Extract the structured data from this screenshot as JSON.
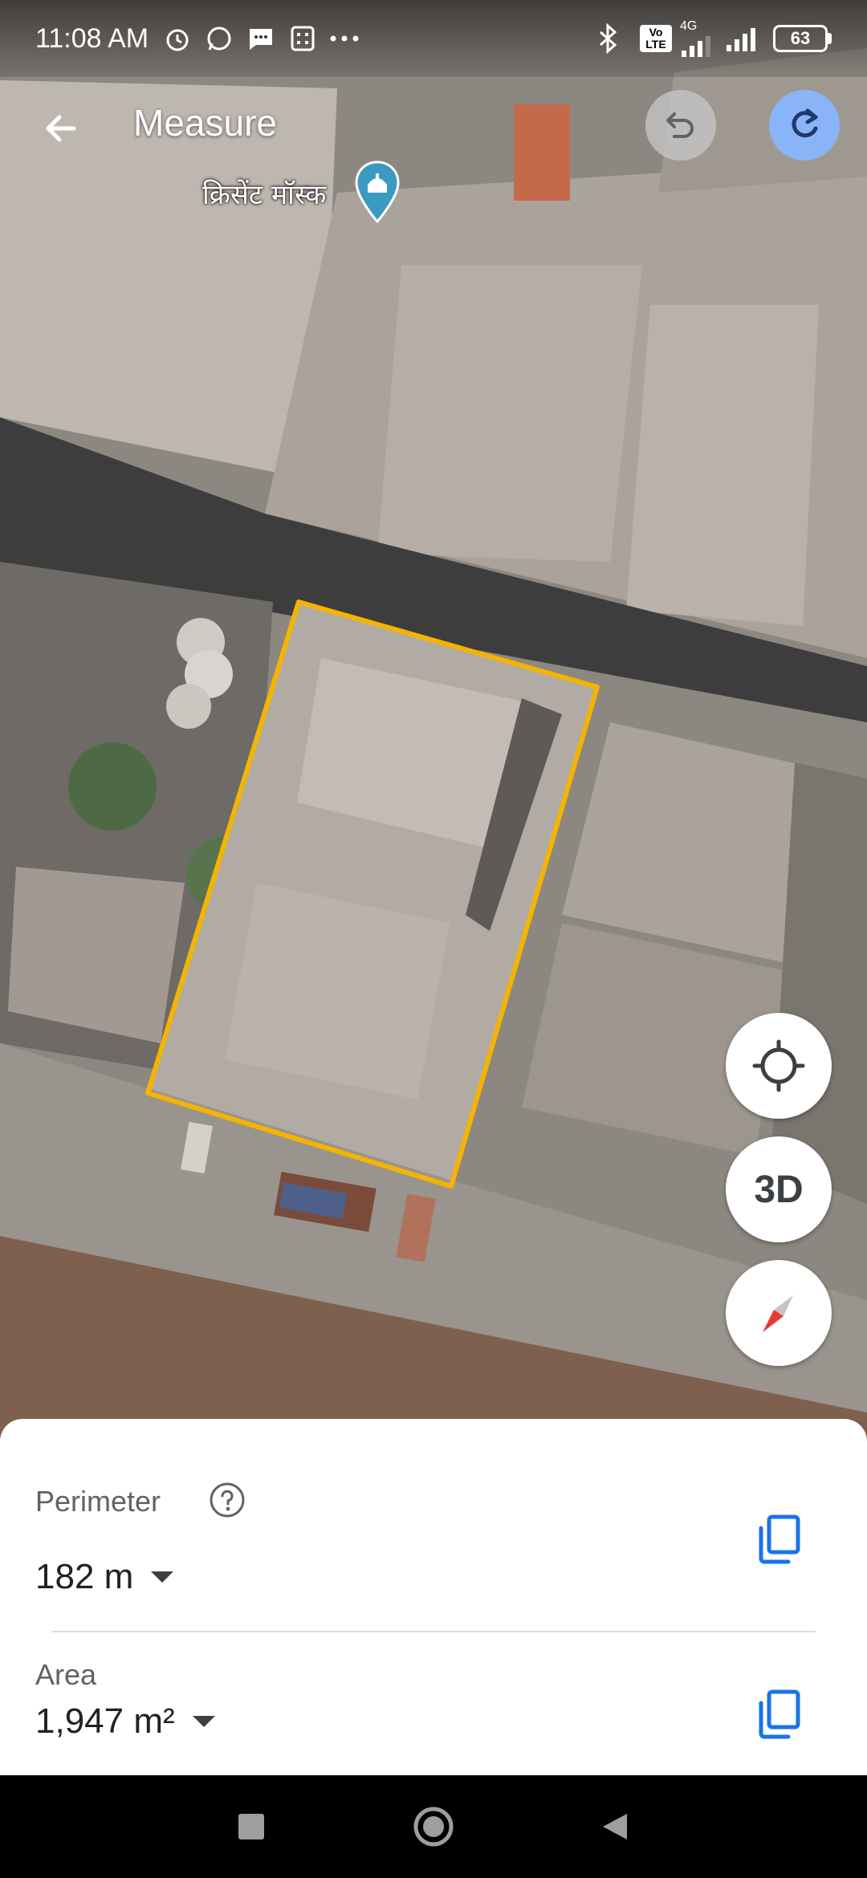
{
  "status_bar": {
    "time": "11:08 AM",
    "network_badge": "Vo LTE",
    "network_type": "4G",
    "battery_level": "63"
  },
  "app_bar": {
    "title": "Measure",
    "back_icon": "arrow-back-icon",
    "undo_icon": "undo-icon",
    "redo_icon": "redo-icon"
  },
  "map": {
    "place_label": "क्रिसेंट मॉस्क",
    "place_icon": "mosque-pin-icon",
    "outline_color": "#f4b400"
  },
  "map_controls": {
    "location_icon": "my-location-icon",
    "three_d_label": "3D",
    "compass_icon": "compass-icon"
  },
  "measurements": {
    "perimeter_label": "Perimeter",
    "perimeter_value": "182 m",
    "area_label": "Area",
    "area_value": "1,947 m²",
    "accent_color": "#1a73e8"
  },
  "nav_bar": {
    "recents_icon": "square-recents-icon",
    "home_icon": "circle-home-icon",
    "back_icon": "triangle-back-icon"
  }
}
